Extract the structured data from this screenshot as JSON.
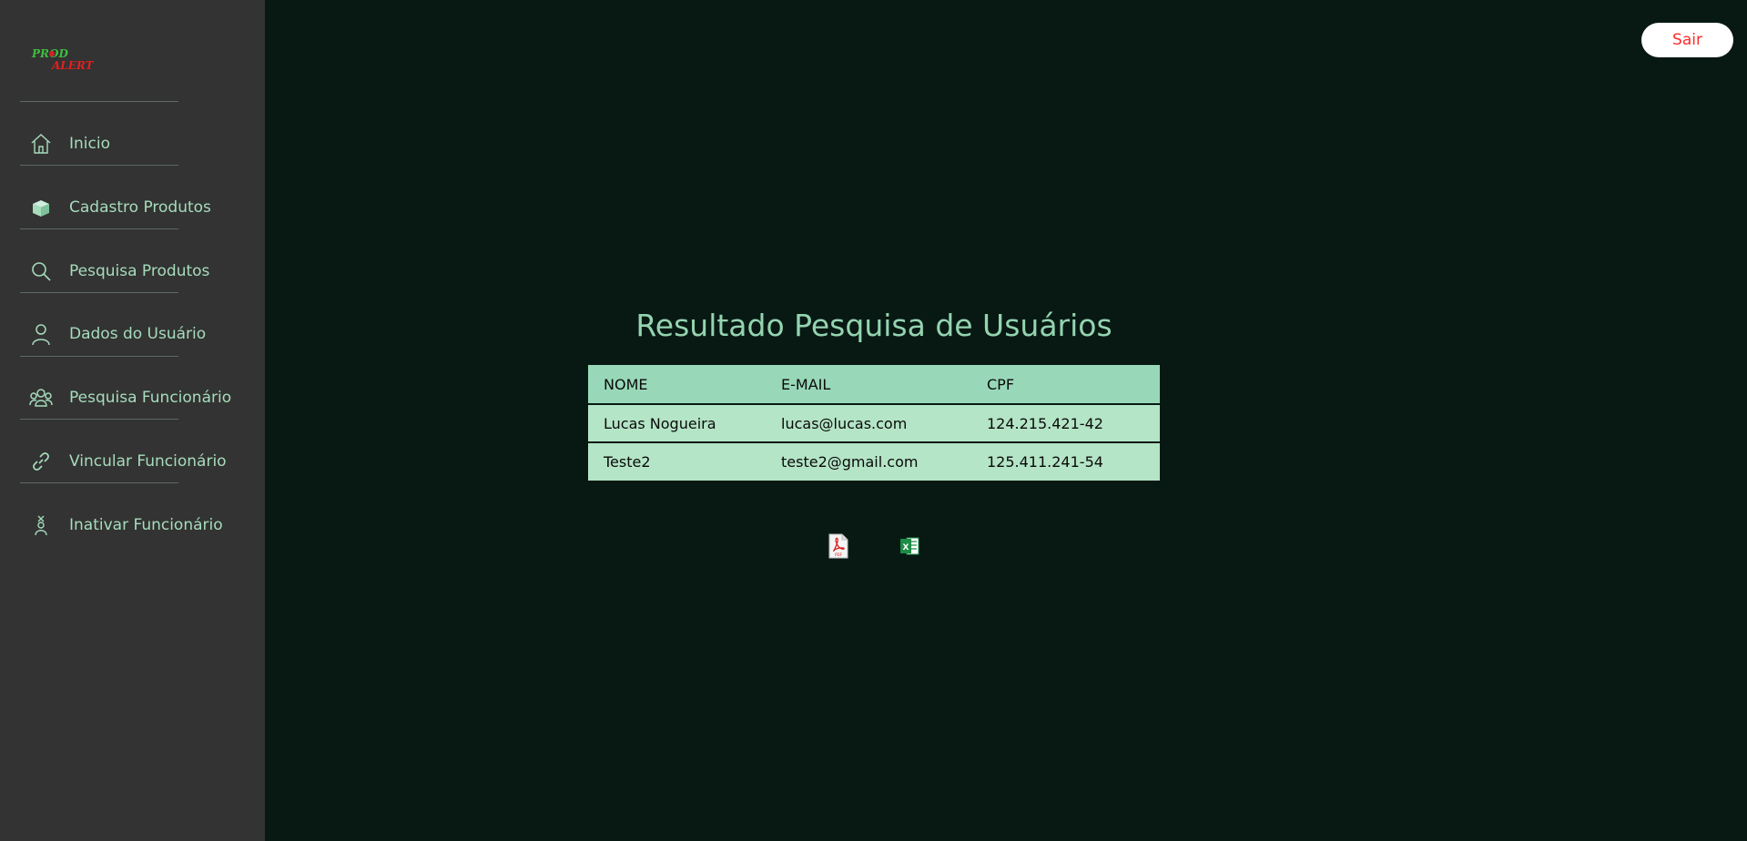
{
  "app": {
    "logo_text_line1": "PROD",
    "logo_text_line2": "ALERT"
  },
  "sidebar": {
    "items": [
      {
        "label": "Inicio",
        "icon": "home-icon"
      },
      {
        "label": "Cadastro Produtos",
        "icon": "box-icon"
      },
      {
        "label": "Pesquisa Produtos",
        "icon": "search-icon"
      },
      {
        "label": "Dados do Usuário",
        "icon": "user-icon"
      },
      {
        "label": "Pesquisa Funcionário",
        "icon": "group-icon"
      },
      {
        "label": "Vincular Funcionário",
        "icon": "link-icon"
      },
      {
        "label": "Inativar Funcionário",
        "icon": "person-x-icon"
      }
    ]
  },
  "header": {
    "logout_label": "Sair"
  },
  "main": {
    "title": "Resultado Pesquisa de Usuários",
    "table": {
      "columns": [
        "NOME",
        "E-MAIL",
        "CPF"
      ],
      "rows": [
        [
          "Lucas Nogueira",
          "lucas@lucas.com",
          "124.215.421-42"
        ],
        [
          "Teste2",
          "teste2@gmail.com",
          "125.411.241-54"
        ]
      ]
    },
    "exports": [
      {
        "icon": "pdf-icon",
        "label": "PDF"
      },
      {
        "icon": "excel-icon",
        "label": "X"
      }
    ]
  },
  "colors": {
    "background": "#081914",
    "sidebar": "#333333",
    "accent": "#94d4b0",
    "header_row": "#98d8b8",
    "body_row": "#b4e5c6",
    "logout_text": "#ff2a2a"
  }
}
